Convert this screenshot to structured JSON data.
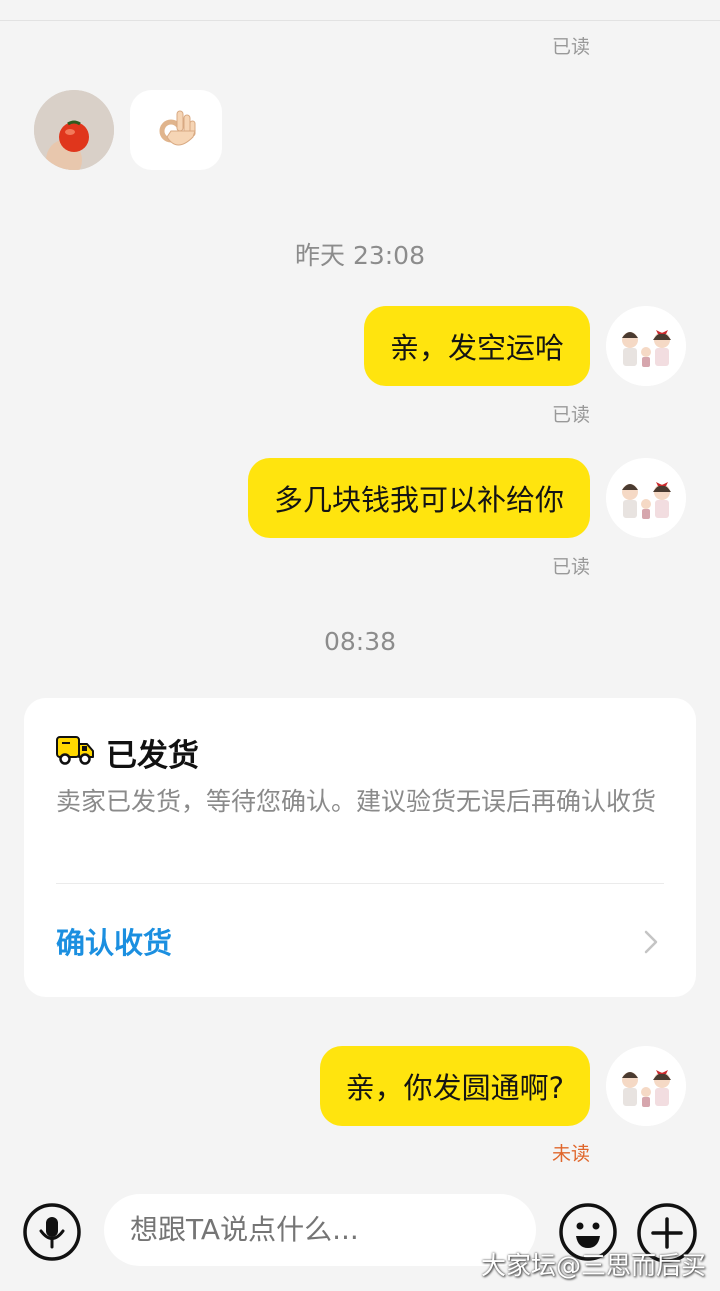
{
  "messages": {
    "read_top": "已读",
    "time_yesterday": "昨天 23:08",
    "msg1": "亲，发空运哈",
    "read1": "已读",
    "msg2": "多几块钱我可以补给你",
    "read2": "已读",
    "time_today": "08:38",
    "msg3": "亲，你发圆通啊?",
    "status3": "未读"
  },
  "shipping_card": {
    "title": "已发货",
    "description": "卖家已发货，等待您确认。建议验货无误后再确认收货",
    "action": "确认收货"
  },
  "input_bar": {
    "placeholder": "想跟TA说点什么..."
  },
  "watermark": "大家坛@三思而后买",
  "colors": {
    "bubble_self": "#ffe40e",
    "action_link": "#1b8fe0",
    "unread": "#e0672c",
    "background": "#f4f4f4"
  },
  "icons": [
    "ok-hand-icon",
    "truck-icon",
    "chevron-right-icon",
    "microphone-icon",
    "smiley-icon",
    "plus-circle-icon"
  ]
}
